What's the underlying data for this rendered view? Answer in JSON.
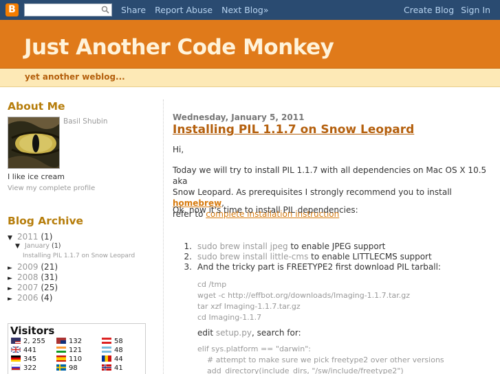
{
  "navbar": {
    "logo_letter": "B",
    "search_placeholder": "",
    "links": [
      "Share",
      "Report Abuse",
      "Next Blog»"
    ],
    "right_links": [
      "Create Blog",
      "Sign In"
    ]
  },
  "header": {
    "title": "Just Another Code Monkey",
    "description": "yet another weblog..."
  },
  "sidebar": {
    "about_heading": "About Me",
    "author_name": "Basil Shubin",
    "about_text": "I like ice cream",
    "profile_link": "View my complete profile",
    "archive_heading": "Blog Archive",
    "archive": [
      {
        "toggle": "▼",
        "label": "2011",
        "count": "(1)"
      },
      {
        "toggle": "▼",
        "label": "January",
        "count": "(1)"
      },
      {
        "toggle": "",
        "label": "Installing PIL 1.1.7 on Snow Leopard",
        "count": ""
      },
      {
        "toggle": "►",
        "label": "2009",
        "count": "(21)"
      },
      {
        "toggle": "►",
        "label": "2008",
        "count": "(31)"
      },
      {
        "toggle": "►",
        "label": "2007",
        "count": "(25)"
      },
      {
        "toggle": "►",
        "label": "2006",
        "count": "(4)"
      }
    ],
    "visitors": {
      "title": "Visitors",
      "rows": [
        [
          "2, 255",
          "132",
          "58"
        ],
        [
          "441",
          "121",
          "48"
        ],
        [
          "345",
          "110",
          "44"
        ],
        [
          "322",
          "98",
          "41"
        ]
      ]
    }
  },
  "post": {
    "date": "Wednesday, January 5, 2011",
    "title": "Installing PIL 1.1.7 on Snow Leopard",
    "greeting": "Hi,",
    "intro_line1": "Today we will try to install PIL 1.1.7 with all dependencies on Mac OS X 10.5 aka",
    "intro_line2a": "Snow Leopard.  As prerequisites I strongly recommend you to install ",
    "homebrew_link": "homebrew",
    "intro_line2b": ",",
    "intro_line3a": "refer to ",
    "install_link": "complete installation instruction",
    "deps_text": "Ok, now it's time to install PIL dependencies:",
    "steps": [
      {
        "num": "1.",
        "cmd": "sudo brew install jpeg",
        "text": " to enable JPEG support"
      },
      {
        "num": "2.",
        "cmd": "sudo brew install little-cms",
        "text": " to enable LITTLECMS support"
      },
      {
        "num": "3.",
        "cmd": "",
        "text": "And the tricky part is FREETYPE2 first download PIL tarball:"
      }
    ],
    "code_block": "cd /tmp\nwget -c http://effbot.org/downloads/Imaging-1.1.7.tar.gz\ntar xzf Imaging-1.1.7.tar.gz\ncd Imaging-1.1.7",
    "edit_prefix": "edit ",
    "edit_file": "setup.py",
    "edit_suffix": ", search for:",
    "code_block2": "elif sys.platform == \"darwin\":\n    # attempt to make sure we pick freetype2 over other versions\n    add_directory(include_dirs, \"/sw/include/freetype2\")"
  }
}
